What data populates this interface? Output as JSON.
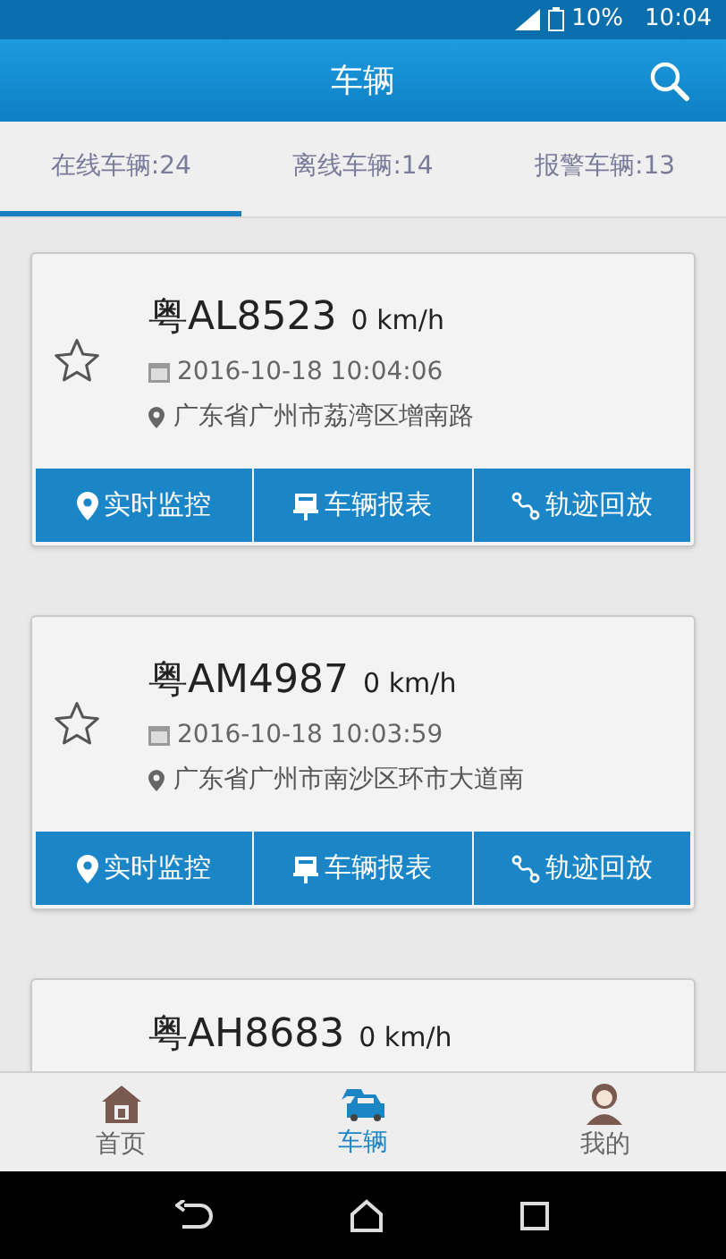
{
  "status_bar": {
    "battery": "10%",
    "time": "10:04"
  },
  "header": {
    "title": "车辆"
  },
  "tabs": [
    {
      "label": "在线车辆:24",
      "selected": true
    },
    {
      "label": "离线车辆:14",
      "selected": false
    },
    {
      "label": "报警车辆:13",
      "selected": false
    }
  ],
  "vehicles": [
    {
      "plate": "粤AL8523",
      "speed": "0 km/h",
      "starred": false,
      "time": "2016-10-18 10:04:06",
      "address": "广东省广州市荔湾区增南路",
      "actions": [
        {
          "kind": "monitor",
          "label": "实时监控"
        },
        {
          "kind": "report",
          "label": "车辆报表"
        },
        {
          "kind": "track",
          "label": "轨迹回放"
        }
      ]
    },
    {
      "plate": "粤AM4987",
      "speed": "0 km/h",
      "starred": false,
      "time": "2016-10-18 10:03:59",
      "address": "广东省广州市南沙区环市大道南",
      "actions": [
        {
          "kind": "monitor",
          "label": "实时监控"
        },
        {
          "kind": "report",
          "label": "车辆报表"
        },
        {
          "kind": "track",
          "label": "轨迹回放"
        }
      ]
    },
    {
      "plate": "粤AH8683",
      "speed": "0 km/h"
    }
  ],
  "bottom_nav": [
    {
      "kind": "home",
      "label": "首页",
      "selected": false
    },
    {
      "kind": "vehicles",
      "label": "车辆",
      "selected": true
    },
    {
      "kind": "mine",
      "label": "我的",
      "selected": false
    }
  ]
}
